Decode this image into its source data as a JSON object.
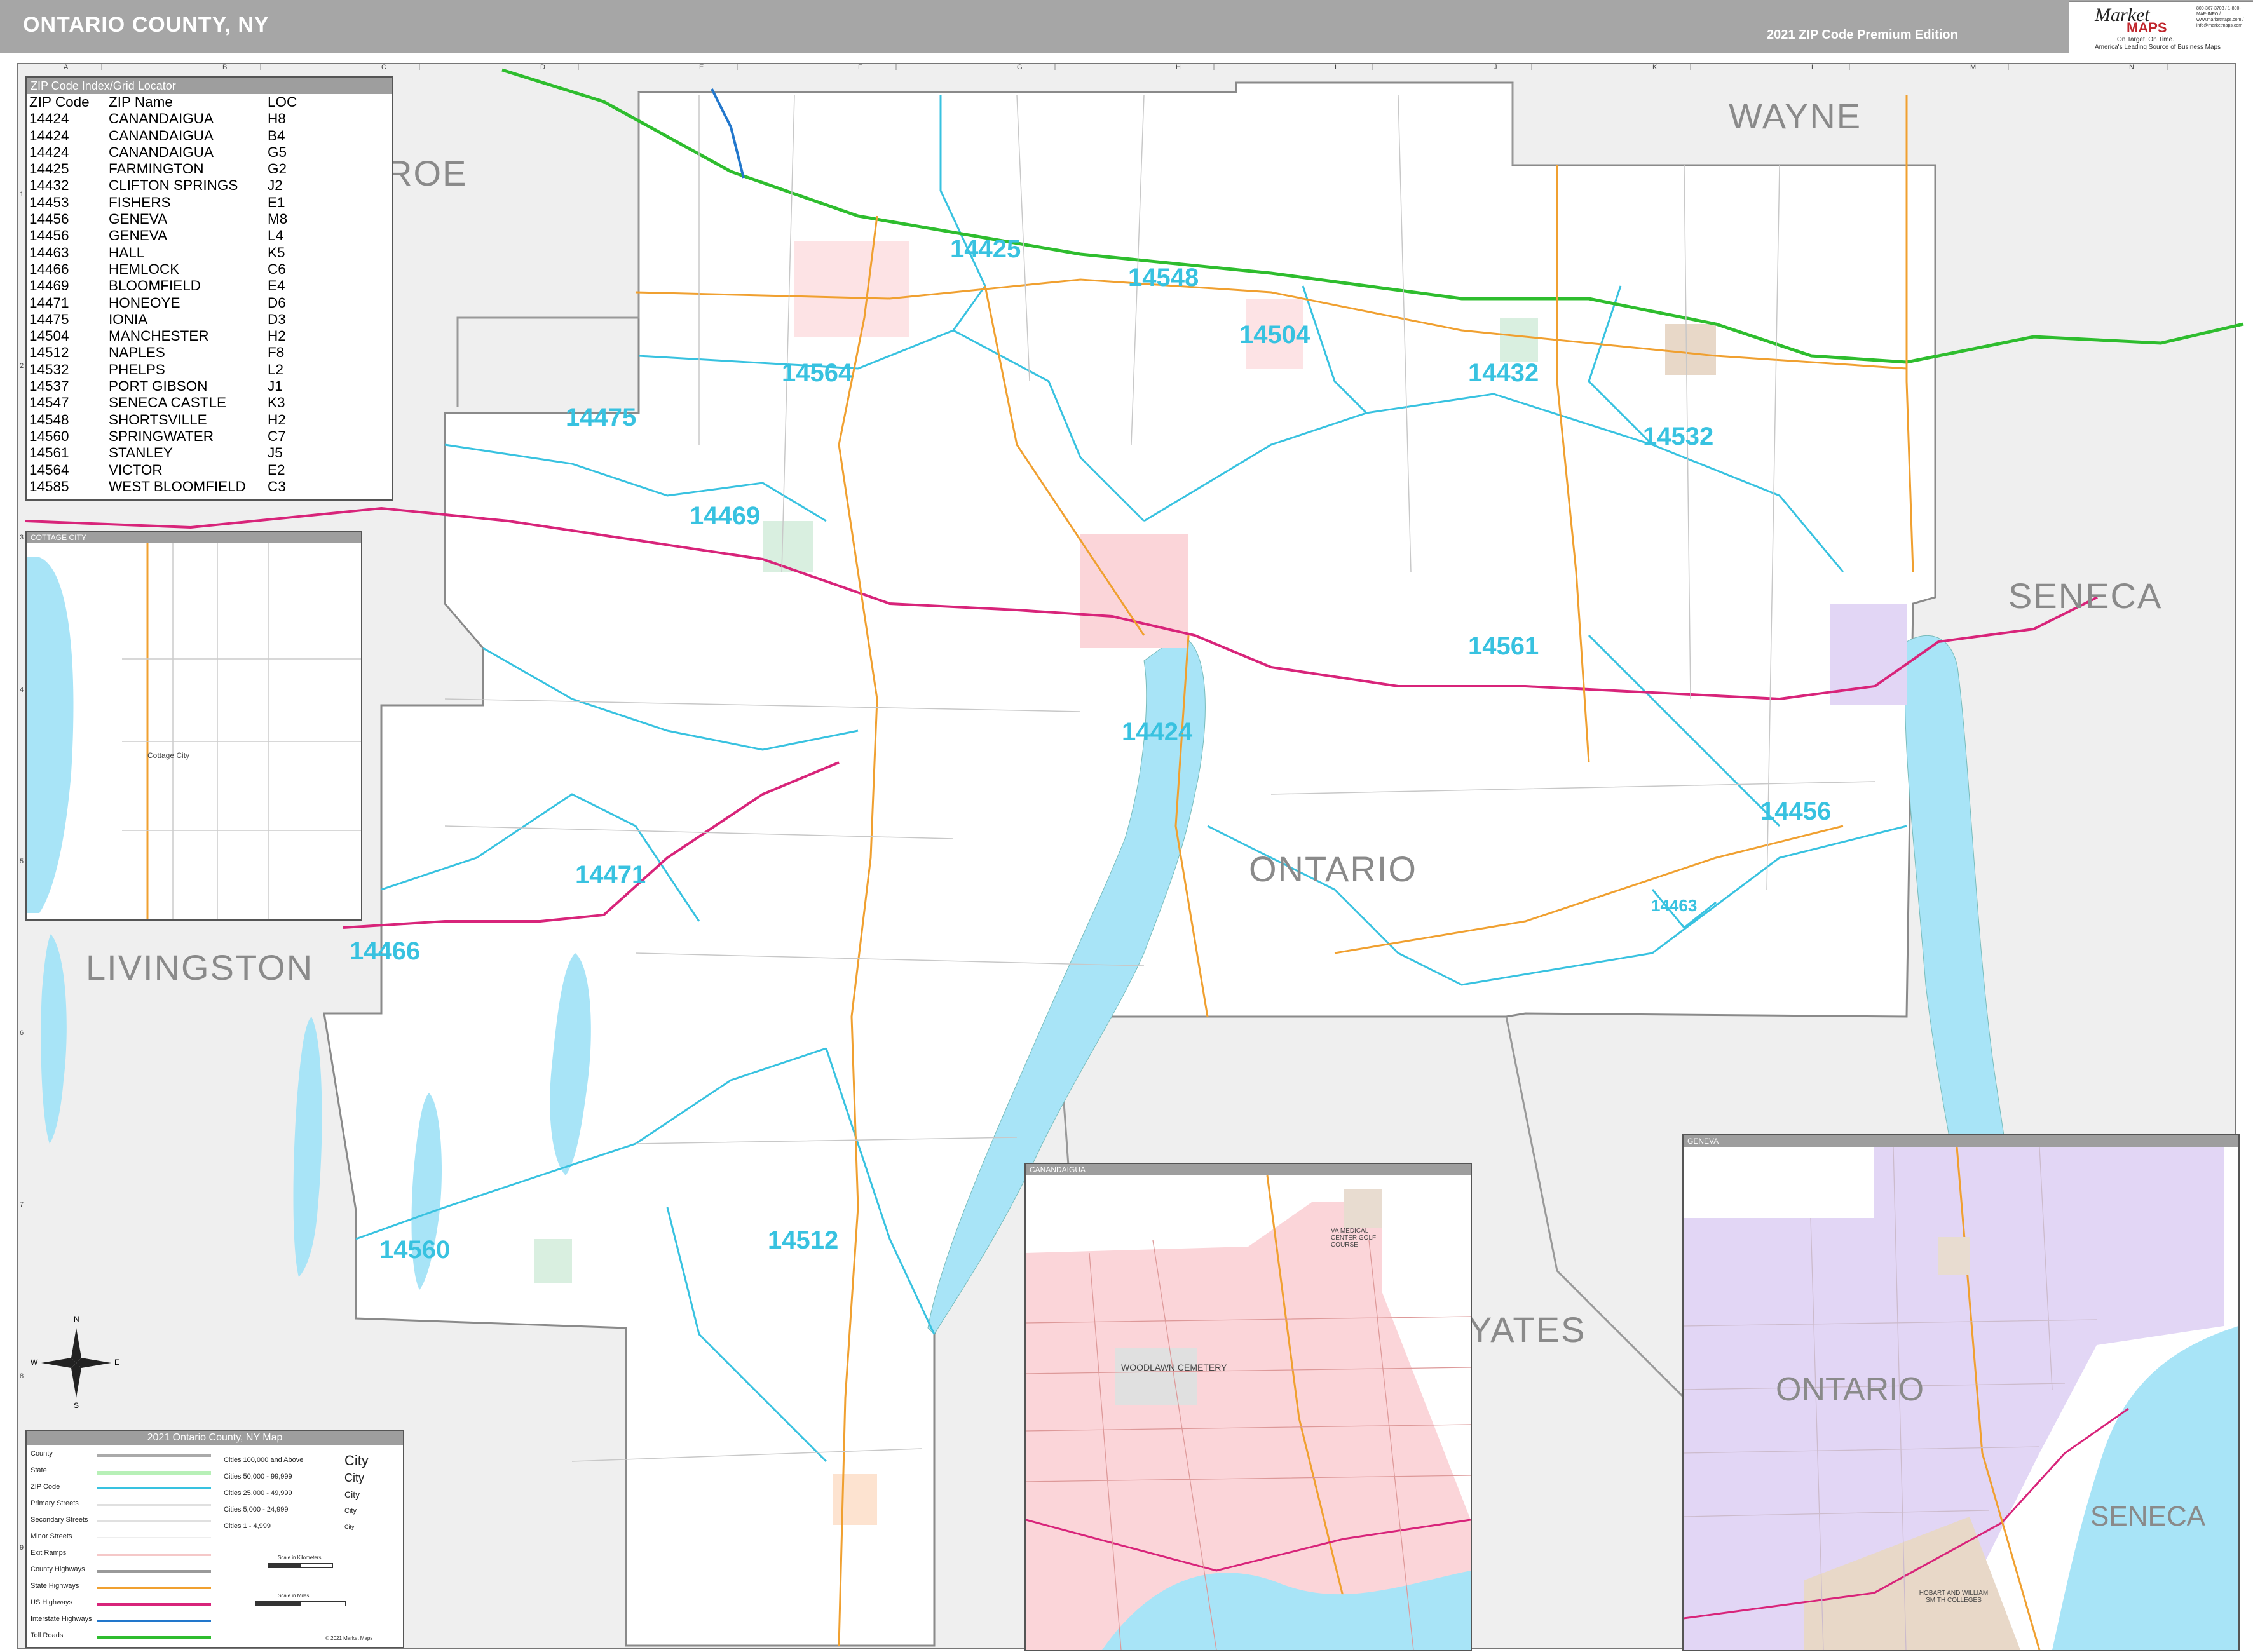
{
  "header": {
    "title": "ONTARIO COUNTY, NY",
    "edition": "2021 ZIP Code Premium Edition"
  },
  "logo": {
    "word1": "Market",
    "word2": "MAPS",
    "tagline1": "On Target. On Time.",
    "tagline2": "America's Leading Source of Business Maps",
    "contact": "800-367-3703 / 1-800-MAP-INFO / www.marketmaps.com / info@marketmaps.com"
  },
  "grid": {
    "columns": [
      "A",
      "B",
      "C",
      "D",
      "E",
      "F",
      "G",
      "H",
      "I",
      "J",
      "K",
      "L",
      "M",
      "N"
    ],
    "rows": [
      "1",
      "2",
      "3",
      "4",
      "5",
      "6",
      "7",
      "8",
      "9"
    ]
  },
  "zip_index": {
    "title": "ZIP Code Index/Grid Locator",
    "headers": [
      "ZIP Code",
      "ZIP Name",
      "LOC"
    ],
    "rows": [
      [
        "14424",
        "CANANDAIGUA",
        "H8"
      ],
      [
        "14424",
        "CANANDAIGUA",
        "B4"
      ],
      [
        "14424",
        "CANANDAIGUA",
        "G5"
      ],
      [
        "14425",
        "FARMINGTON",
        "G2"
      ],
      [
        "14432",
        "CLIFTON SPRINGS",
        "J2"
      ],
      [
        "14453",
        "FISHERS",
        "E1"
      ],
      [
        "14456",
        "GENEVA",
        "M8"
      ],
      [
        "14456",
        "GENEVA",
        "L4"
      ],
      [
        "14463",
        "HALL",
        "K5"
      ],
      [
        "14466",
        "HEMLOCK",
        "C6"
      ],
      [
        "14469",
        "BLOOMFIELD",
        "E4"
      ],
      [
        "14471",
        "HONEOYE",
        "D6"
      ],
      [
        "14475",
        "IONIA",
        "D3"
      ],
      [
        "14504",
        "MANCHESTER",
        "H2"
      ],
      [
        "14512",
        "NAPLES",
        "F8"
      ],
      [
        "14532",
        "PHELPS",
        "L2"
      ],
      [
        "14537",
        "PORT GIBSON",
        "J1"
      ],
      [
        "14547",
        "SENECA CASTLE",
        "K3"
      ],
      [
        "14548",
        "SHORTSVILLE",
        "H2"
      ],
      [
        "14560",
        "SPRINGWATER",
        "C7"
      ],
      [
        "14561",
        "STANLEY",
        "J5"
      ],
      [
        "14564",
        "VICTOR",
        "E2"
      ],
      [
        "14585",
        "WEST BLOOMFIELD",
        "C3"
      ]
    ]
  },
  "zip_labels": [
    "14425",
    "14548",
    "14504",
    "14432",
    "14564",
    "14475",
    "14532",
    "14469",
    "14561",
    "14424",
    "14456",
    "14471",
    "14466",
    "14463",
    "14560",
    "14512"
  ],
  "county_labels": [
    "ONROE",
    "WAYNE",
    "SENECA",
    "ONTARIO",
    "LIVINGSTON",
    "YATES"
  ],
  "insets": {
    "cottage_city": {
      "title": "COTTAGE CITY",
      "place": "Cottage City"
    },
    "canandaigua": {
      "title": "CANANDAIGUA",
      "place1": "WOODLAWN CEMETERY",
      "place2": "VA MEDICAL CENTER GOLF COURSE"
    },
    "geneva": {
      "title": "GENEVA",
      "label1": "ONTARIO",
      "label2": "SENECA",
      "place1": "HOBART AND WILLIAM SMITH COLLEGES"
    }
  },
  "legend": {
    "title": "2021 Ontario County, NY Map",
    "items": [
      "County",
      "State",
      "ZIP Code",
      "Primary Streets",
      "Secondary Streets",
      "Minor Streets",
      "Exit Ramps",
      "County Highways",
      "State Highways",
      "US Highways",
      "Interstate Highways",
      "Toll Roads"
    ],
    "populations": [
      "Cities 100,000 and Above",
      "Cities 50,000 - 99,999",
      "Cities 25,000 - 49,999",
      "Cities 5,000 - 24,999",
      "Cities 1 - 4,999"
    ],
    "city_samples": [
      "City",
      "City",
      "City",
      "City",
      "City"
    ],
    "scale_km": "Scale in Kilometers",
    "scale_mi": "Scale in Miles",
    "copyright": "© 2021 Market Maps"
  },
  "compass": {
    "n": "N",
    "s": "S",
    "e": "E",
    "w": "W"
  },
  "colors": {
    "header": "#a6a6a6",
    "zip_boundary": "#38c2e0",
    "interstate": "#2ebd2e",
    "us_highway": "#d8247a",
    "state_highway": "#f0a030",
    "water": "#a8e4f7",
    "outside_county": "#efefef",
    "canandaigua_city": "#fbd5d9",
    "geneva_city": "#e2d6f5"
  }
}
